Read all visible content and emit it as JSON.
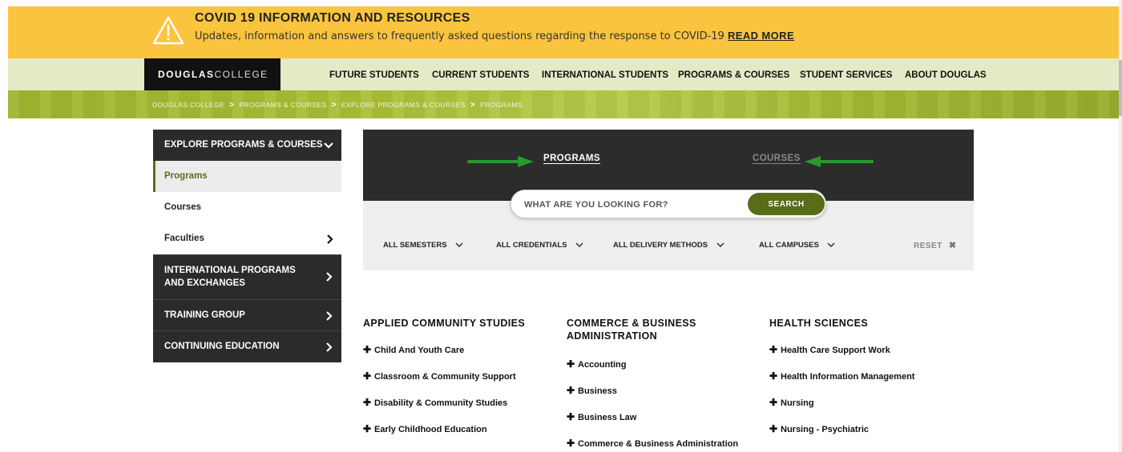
{
  "covid": {
    "title": "COVID 19 INFORMATION AND RESOURCES",
    "text": "Updates, information and answers to frequently asked questions regarding the response to COVID-19",
    "link": "READ MORE"
  },
  "logo": {
    "bold": "DOUGLAS",
    "light": "COLLEGE"
  },
  "nav": [
    "FUTURE STUDENTS",
    "CURRENT STUDENTS",
    "INTERNATIONAL STUDENTS",
    "PROGRAMS & COURSES",
    "STUDENT SERVICES",
    "ABOUT DOUGLAS"
  ],
  "breadcrumb": [
    "DOUGLAS COLLEGE",
    "PROGRAMS & COURSES",
    "EXPLORE PROGRAMS & COURSES",
    "PROGRAMS"
  ],
  "sidebar": {
    "header": "EXPLORE PROGRAMS & COURSES",
    "items": [
      "Programs",
      "Courses",
      "Faculties"
    ],
    "sections": [
      "INTERNATIONAL PROGRAMS AND EXCHANGES",
      "TRAINING GROUP",
      "CONTINUING EDUCATION"
    ]
  },
  "tabs": {
    "programs": "PROGRAMS",
    "courses": "COURSES"
  },
  "search": {
    "placeholder": "WHAT ARE YOU LOOKING FOR?",
    "button": "SEARCH"
  },
  "filters": [
    "ALL SEMESTERS",
    "ALL CREDENTIALS",
    "ALL DELIVERY METHODS",
    "ALL CAMPUSES"
  ],
  "reset": "RESET",
  "columns": [
    {
      "title": "APPLIED COMMUNITY STUDIES",
      "items": [
        "Child And Youth Care",
        "Classroom & Community Support",
        "Disability & Community Studies",
        "Early Childhood Education"
      ]
    },
    {
      "title": "COMMERCE & BUSINESS ADMINISTRATION",
      "items": [
        "Accounting",
        "Business",
        "Business Law",
        "Commerce & Business Administration"
      ]
    },
    {
      "title": "HEALTH SCIENCES",
      "items": [
        "Health Care Support Work",
        "Health Information Management",
        "Nursing",
        "Nursing - Psychiatric"
      ]
    }
  ],
  "colors": {
    "banner": "#fbc43f",
    "accent": "#596c17",
    "arrows": "#2a9a2e",
    "dark": "#2c2c2c"
  },
  "icons": [
    "warning-icon",
    "chevron-down-icon",
    "chevron-right-icon",
    "plus-icon",
    "close-icon"
  ]
}
